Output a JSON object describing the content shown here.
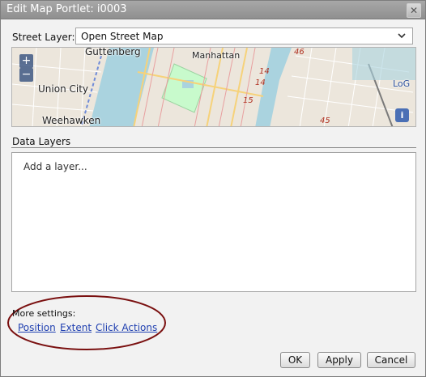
{
  "window": {
    "title": "Edit Map Portlet: i0003",
    "close_icon": "close-icon"
  },
  "street_layer": {
    "label": "Street Layer:",
    "value": "Open Street Map"
  },
  "map": {
    "zoom_in": "+",
    "zoom_out": "−",
    "info": "i",
    "labels": {
      "guttenberg": "Guttenberg",
      "manhattan": "Manhattan",
      "union_city": "Union City",
      "weehawken": "Weehawken",
      "loc": "LoG"
    },
    "route_numbers": [
      "46",
      "14",
      "14",
      "15",
      "45"
    ]
  },
  "data_layers": {
    "label": "Data Layers",
    "placeholder": "Add a layer..."
  },
  "more_settings": {
    "label": "More settings:",
    "links": [
      "Position",
      "Extent",
      "Click Actions"
    ]
  },
  "buttons": {
    "ok": "OK",
    "apply": "Apply",
    "cancel": "Cancel"
  },
  "colors": {
    "title_bar": "#9a9a9a",
    "link": "#1f3fb0",
    "annotation_ellipse": "#7a1010",
    "water": "#aad3df",
    "park": "#c8facc"
  }
}
